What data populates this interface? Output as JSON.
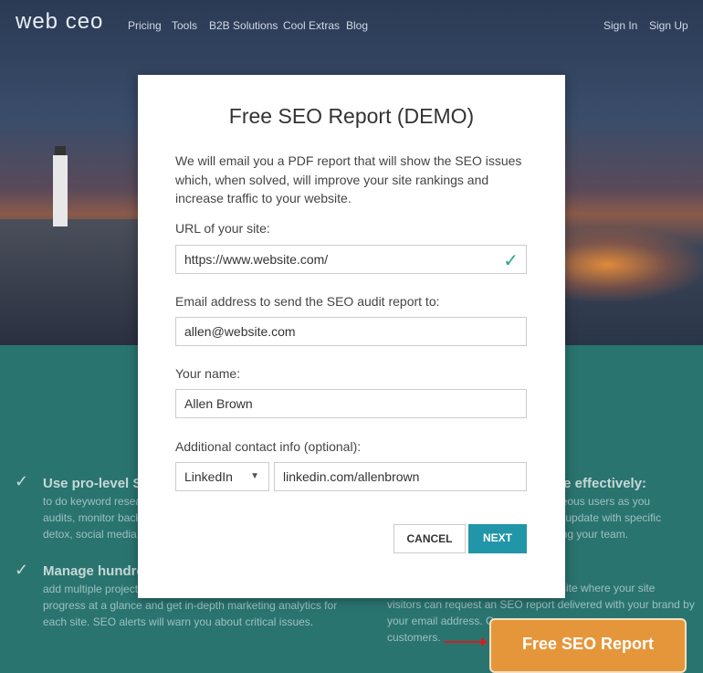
{
  "nav": {
    "logo": "web ceo",
    "links": [
      "Pricing",
      "Tools",
      "B2B Solutions",
      "Cool Extras",
      "Blog"
    ],
    "sign_in": "Sign In",
    "sign_up": "Sign Up"
  },
  "features": {
    "left1": {
      "title": "Use pro-level S",
      "lines": [
        "to do keyword resear",
        "audits, monitor back",
        "detox, social media a"
      ]
    },
    "left2": {
      "title": "Manage hundre",
      "lines": [
        "add multiple projects",
        "progress at a glance and get in-depth marketing analytics for",
        "each site. SEO alerts will warn you about critical issues."
      ]
    },
    "right1": {
      "title": "rate effectively:",
      "lines": [
        "taneous users as you",
        "ally update with specific",
        "mong your team."
      ]
    },
    "right2": {
      "lines": [
        "ur site where your site",
        "visitors can request an SEO report delivered with your brand by",
        "your email address. C",
        "customers."
      ]
    }
  },
  "modal": {
    "title": "Free SEO Report (DEMO)",
    "intro": "We will email you a PDF report that will show the SEO issues which, when solved, will improve your site rankings and increase traffic to your website.",
    "url_label": "URL of your site:",
    "url_value": "https://www.website.com/",
    "email_label": "Email address to send the SEO audit report to:",
    "email_value": "allen@website.com",
    "name_label": "Your name:",
    "name_value": "Allen Brown",
    "contact_label": "Additional contact info (optional):",
    "contact_type": "LinkedIn",
    "contact_value": "linkedin.com/allenbrown",
    "cancel": "CANCEL",
    "next": "NEXT"
  },
  "cta": "Free SEO Report",
  "colors": {
    "teal": "#2a7470",
    "next": "#2196a8",
    "cta": "#e6963a",
    "valid": "#2aa58a"
  }
}
